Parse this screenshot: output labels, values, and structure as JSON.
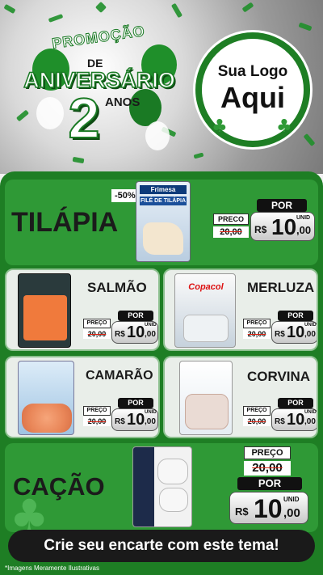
{
  "header": {
    "promo_word": "PROMOÇÃO",
    "de_word": "DE",
    "aniversario_word": "ANIVERSÁRIO",
    "number": "2",
    "anos_word": "ANOS",
    "logo_line1": "Sua Logo",
    "logo_line2": "Aqui"
  },
  "featured_top": {
    "name": "TILÁPIA",
    "brand": "Frimesa",
    "package_title": "FILÉ DE TILÁPIA",
    "discount": "-50%",
    "preco_label": "PRECO",
    "old_price": "20,00",
    "por_label": "POR",
    "currency": "R$",
    "price_int": "10",
    "price_dec": ",00",
    "unit": "UNID"
  },
  "products": [
    {
      "name": "SALMÃO",
      "preco_label": "PREÇO",
      "old_price": "20,00",
      "por_label": "POR",
      "currency": "R$",
      "price_int": "10",
      "price_dec": ",00",
      "unit": "UNID"
    },
    {
      "name": "MERLUZA",
      "brand": "Copacol",
      "preco_label": "PREÇO",
      "old_price": "20,00",
      "por_label": "POR",
      "currency": "R$",
      "price_int": "10",
      "price_dec": ",00",
      "unit": "UNID"
    },
    {
      "name": "CAMARÃO",
      "preco_label": "PREÇO",
      "old_price": "20,00",
      "por_label": "POR",
      "currency": "R$",
      "price_int": "10",
      "price_dec": ",00",
      "unit": "UNID"
    },
    {
      "name": "CORVINA",
      "preco_label": "PREÇO",
      "old_price": "20,00",
      "por_label": "POR",
      "currency": "R$",
      "price_int": "10",
      "price_dec": ",00",
      "unit": "UNID"
    }
  ],
  "featured_bottom": {
    "name": "CAÇÃO",
    "preco_label": "PREÇO",
    "old_price": "20,00",
    "por_label": "POR",
    "currency": "R$",
    "price_int": "10",
    "price_dec": ",00",
    "unit": "UNID"
  },
  "cta": "Crie seu encarte com este tema!",
  "footnote": "*Imagens Meramente Ilustrativas",
  "colors": {
    "green_dark": "#1e7e24",
    "green_card": "#2f9936",
    "green_light": "#8dc08f"
  }
}
